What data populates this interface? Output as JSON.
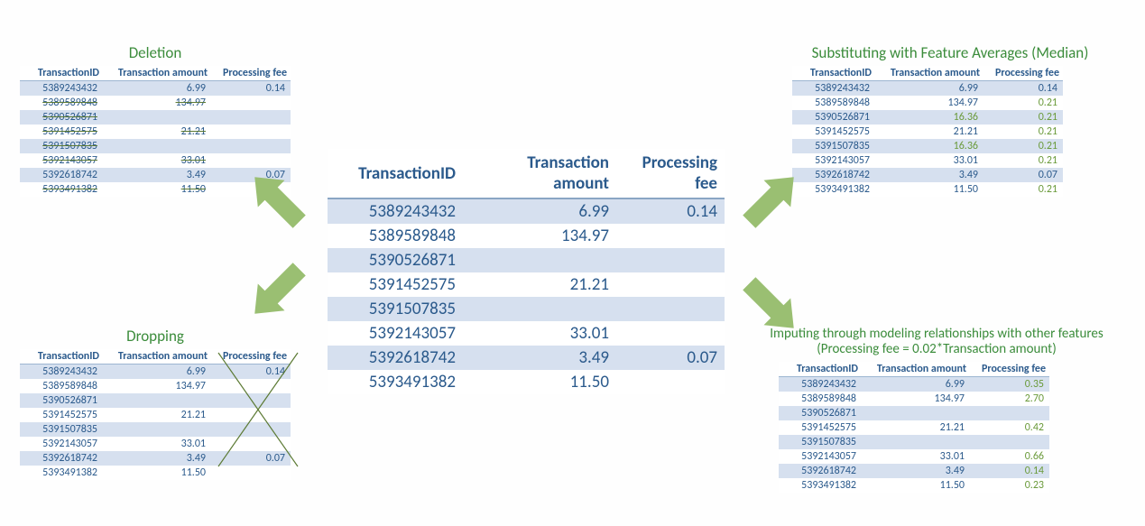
{
  "columns": [
    "TransactionID",
    "Transaction amount",
    "Processing fee"
  ],
  "center_rows": [
    {
      "id": "5389243432",
      "amt": "6.99",
      "fee": "0.14"
    },
    {
      "id": "5389589848",
      "amt": "134.97",
      "fee": ""
    },
    {
      "id": "5390526871",
      "amt": "",
      "fee": ""
    },
    {
      "id": "5391452575",
      "amt": "21.21",
      "fee": ""
    },
    {
      "id": "5391507835",
      "amt": "",
      "fee": ""
    },
    {
      "id": "5392143057",
      "amt": "33.01",
      "fee": ""
    },
    {
      "id": "5392618742",
      "amt": "3.49",
      "fee": "0.07"
    },
    {
      "id": "5393491382",
      "amt": "11.50",
      "fee": ""
    }
  ],
  "deletion": {
    "title": "Deletion",
    "rows": [
      {
        "id": "5389243432",
        "amt": "6.99",
        "fee": "0.14",
        "strike": false
      },
      {
        "id": "5389589848",
        "amt": "134.97",
        "fee": "",
        "strike": true
      },
      {
        "id": "5390526871",
        "amt": "",
        "fee": "",
        "strike": true
      },
      {
        "id": "5391452575",
        "amt": "21.21",
        "fee": "",
        "strike": true
      },
      {
        "id": "5391507835",
        "amt": "",
        "fee": "",
        "strike": true
      },
      {
        "id": "5392143057",
        "amt": "33.01",
        "fee": "",
        "strike": true
      },
      {
        "id": "5392618742",
        "amt": "3.49",
        "fee": "0.07",
        "strike": false
      },
      {
        "id": "5393491382",
        "amt": "11.50",
        "fee": "",
        "strike": true
      }
    ]
  },
  "dropping": {
    "title": "Dropping",
    "rows": [
      {
        "id": "5389243432",
        "amt": "6.99",
        "fee": "0.14"
      },
      {
        "id": "5389589848",
        "amt": "134.97",
        "fee": ""
      },
      {
        "id": "5390526871",
        "amt": "",
        "fee": ""
      },
      {
        "id": "5391452575",
        "amt": "21.21",
        "fee": ""
      },
      {
        "id": "5391507835",
        "amt": "",
        "fee": ""
      },
      {
        "id": "5392143057",
        "amt": "33.01",
        "fee": ""
      },
      {
        "id": "5392618742",
        "amt": "3.49",
        "fee": "0.07"
      },
      {
        "id": "5393491382",
        "amt": "11.50",
        "fee": ""
      }
    ]
  },
  "median": {
    "title": "Substituting with Feature Averages (Median)",
    "rows": [
      {
        "id": "5389243432",
        "amt": "6.99",
        "fee": "0.14",
        "amt_imp": false,
        "fee_imp": false
      },
      {
        "id": "5389589848",
        "amt": "134.97",
        "fee": "0.21",
        "amt_imp": false,
        "fee_imp": true
      },
      {
        "id": "5390526871",
        "amt": "16.36",
        "fee": "0.21",
        "amt_imp": true,
        "fee_imp": true
      },
      {
        "id": "5391452575",
        "amt": "21.21",
        "fee": "0.21",
        "amt_imp": false,
        "fee_imp": true
      },
      {
        "id": "5391507835",
        "amt": "16.36",
        "fee": "0.21",
        "amt_imp": true,
        "fee_imp": true
      },
      {
        "id": "5392143057",
        "amt": "33.01",
        "fee": "0.21",
        "amt_imp": false,
        "fee_imp": true
      },
      {
        "id": "5392618742",
        "amt": "3.49",
        "fee": "0.07",
        "amt_imp": false,
        "fee_imp": false
      },
      {
        "id": "5393491382",
        "amt": "11.50",
        "fee": "0.21",
        "amt_imp": false,
        "fee_imp": true
      }
    ]
  },
  "imputing": {
    "title": "Imputing through modeling relationships with other features (Processing fee = 0.02*Transaction amount)",
    "rows": [
      {
        "id": "5389243432",
        "amt": "6.99",
        "fee": "0.35",
        "fee_imp": true
      },
      {
        "id": "5389589848",
        "amt": "134.97",
        "fee": "2.70",
        "fee_imp": true
      },
      {
        "id": "5390526871",
        "amt": "",
        "fee": "",
        "fee_imp": false
      },
      {
        "id": "5391452575",
        "amt": "21.21",
        "fee": "0.42",
        "fee_imp": true
      },
      {
        "id": "5391507835",
        "amt": "",
        "fee": "",
        "fee_imp": false
      },
      {
        "id": "5392143057",
        "amt": "33.01",
        "fee": "0.66",
        "fee_imp": true
      },
      {
        "id": "5392618742",
        "amt": "3.49",
        "fee": "0.14",
        "fee_imp": true
      },
      {
        "id": "5393491382",
        "amt": "11.50",
        "fee": "0.23",
        "fee_imp": true
      }
    ]
  }
}
